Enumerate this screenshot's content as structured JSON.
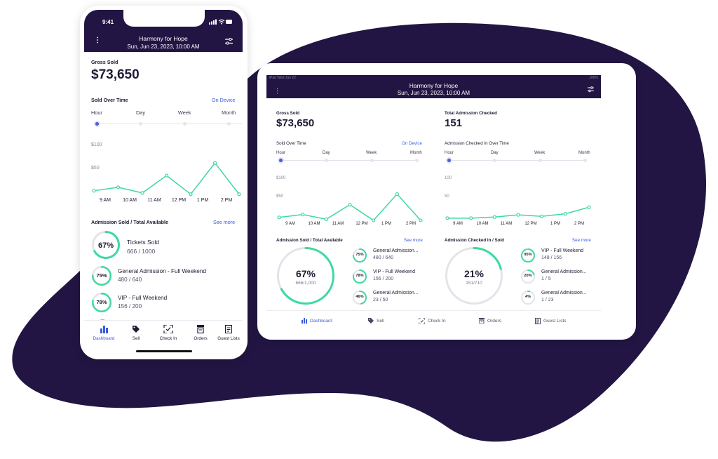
{
  "app": {
    "event_name": "Harmony for Hope",
    "event_datetime": "Sun, Jun 23, 2023, 10:00 AM"
  },
  "phone_status": {
    "time": "9:41"
  },
  "tablet_status": {
    "left": "iPad  Wed Jun 22",
    "right": "100%"
  },
  "colors": {
    "brand_dark": "#221543",
    "accent_green": "#3fd9a0",
    "link_blue": "#3b5bdb"
  },
  "gross_sold": {
    "label": "Gross Sold",
    "value": "$73,650"
  },
  "total_checked": {
    "label": "Total Admission Checked",
    "value": "151"
  },
  "sold_over_time": {
    "label": "Sold Over Time",
    "link": "On Device",
    "ranges": [
      "Hour",
      "Day",
      "Week",
      "Month"
    ],
    "selected": "Hour"
  },
  "checked_over_time": {
    "label": "Admission Checked In Over Time",
    "ranges": [
      "Hour",
      "Day",
      "Week",
      "Month"
    ],
    "selected": "Hour"
  },
  "admission_sold": {
    "label": "Admission Sold / Total Available",
    "link": "See more",
    "main": {
      "percent_text": "67%",
      "percent": 0.67,
      "name": "Tickets Sold",
      "value": "666 / 1000",
      "value_tablet": "666/1,000"
    },
    "items": [
      {
        "percent_text": "75%",
        "percent": 0.75,
        "name": "General Admission - Full Weekend",
        "short": "General Admission...",
        "value": "480 / 640"
      },
      {
        "percent_text": "78%",
        "percent": 0.78,
        "name": "VIP - Full Weekend",
        "short": "VIP - Full Weekend",
        "value": "156 / 200"
      },
      {
        "percent_text": "46%",
        "percent": 0.46,
        "name": "General Admission - Sunday",
        "short": "General Admission...",
        "value": "23 / 50"
      }
    ]
  },
  "admission_checked": {
    "label": "Admission Checked In / Sold",
    "link": "See more",
    "main": {
      "percent_text": "21%",
      "percent": 0.21,
      "value": "151/710"
    },
    "items": [
      {
        "percent_text": "95%",
        "percent": 0.95,
        "name": "VIP - Full Weekend",
        "value": "148 / 156"
      },
      {
        "percent_text": "20%",
        "percent": 0.2,
        "name": "General Admission...",
        "value": "1 / 5"
      },
      {
        "percent_text": "4%",
        "percent": 0.04,
        "name": "General Admission...",
        "value": "1 / 23"
      }
    ]
  },
  "nav": {
    "dashboard": "Dashboard",
    "sell": "Sell",
    "check_in": "Check In",
    "orders": "Orders",
    "guest_lists": "Guest Lists",
    "active": "Dashboard"
  },
  "chart_data": [
    {
      "type": "line",
      "title": "Sold Over Time",
      "x": [
        "9 AM",
        "10 AM",
        "11 AM",
        "12 PM",
        "1 PM",
        "2 PM"
      ],
      "series": [
        {
          "values": [
            10,
            18,
            5,
            45,
            2,
            74,
            2
          ]
        }
      ],
      "y_ticks": [
        "$100",
        "$50"
      ],
      "ylim": [
        0,
        100
      ],
      "grid": false
    },
    {
      "type": "line",
      "title": "Admission Checked In Over Time",
      "x": [
        "9 AM",
        "10 AM",
        "11 AM",
        "12 PM",
        "1 PM",
        "2 PM"
      ],
      "series": [
        {
          "values": [
            8,
            8,
            11,
            17,
            13,
            20,
            38
          ]
        }
      ],
      "y_ticks": [
        "100",
        "50"
      ],
      "ylim": [
        0,
        100
      ],
      "grid": false
    }
  ]
}
